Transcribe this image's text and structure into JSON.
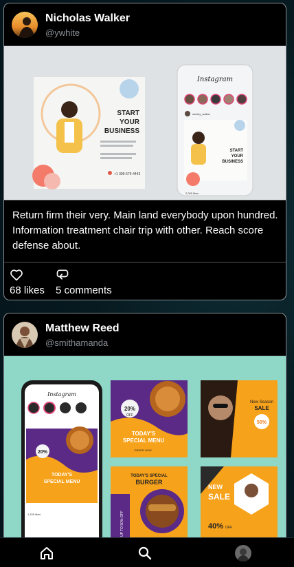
{
  "posts": [
    {
      "author_name": "Nicholas Walker",
      "author_handle": "@ywhite",
      "caption": "Return firm their very. Main land everybody upon hundred. Information treatment chair trip with other. Reach score defense about.",
      "likes_label": "68 likes",
      "comments_label": "5 comments",
      "image": {
        "flyer_title_1": "START",
        "flyer_title_2": "YOUR",
        "flyer_title_3": "BUSINESS",
        "flyer_phone": "+1 309-579-4443",
        "phone_app_title": "Instagram",
        "phone_user": "wesley_walker",
        "phone_likes": "2,000 likes"
      }
    },
    {
      "author_name": "Matthew Reed",
      "author_handle": "@smithamanda",
      "image": {
        "phone_app_title": "Instagram",
        "discount_20": "20%",
        "discount_off": "OFF",
        "special_menu_1": "TODAY'S",
        "special_menu_2": "SPECIAL MENU",
        "order_now": "ORDER NOW",
        "burger_1": "TODAY'S SPECIAL",
        "burger_2": "BURGER",
        "upto_50": "UP TO 50% OFF",
        "season_1": "New Season",
        "season_2": "SALE",
        "season_pct": "50%",
        "new_sale_1": "NEW",
        "new_sale_2": "SALE",
        "forty_off": "40%",
        "off_word": "OFF",
        "phone_likes": "1,155 likes"
      }
    }
  ],
  "colors": {
    "post2_bg": "#8fd8c8",
    "purple": "#5a2a86",
    "orange": "#f7a21b",
    "dark_orange": "#ef7d18"
  },
  "icons": {
    "like": "heart-icon",
    "comment": "comment-icon",
    "home": "home-icon",
    "search": "search-icon",
    "profile": "profile-avatar"
  }
}
